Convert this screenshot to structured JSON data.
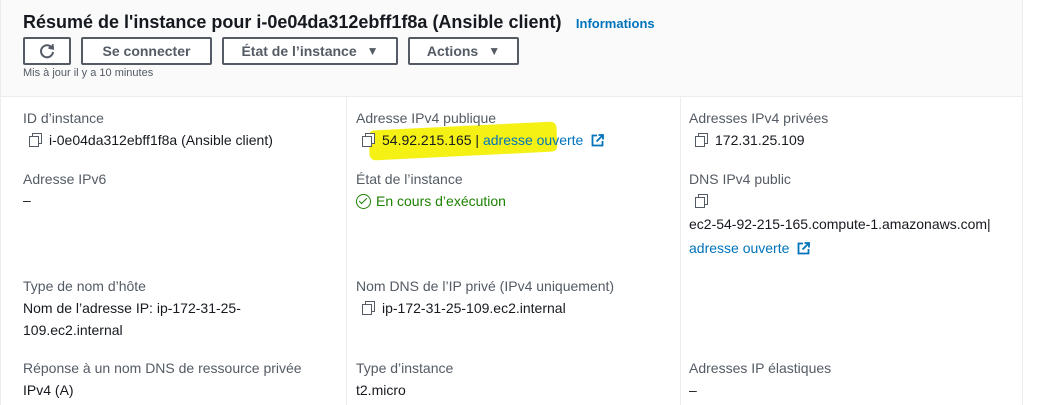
{
  "header": {
    "title": "Résumé de l'instance pour i-0e04da312ebff1f8a (Ansible client)",
    "info_link": "Informations",
    "connect_button": "Se connecter",
    "state_button": "État de l’instance",
    "actions_button": "Actions",
    "updated": "Mis à jour il y a 10 minutes"
  },
  "fields": {
    "instance_id": {
      "label": "ID d’instance",
      "value": "i-0e04da312ebff1f8a (Ansible client)"
    },
    "public_ipv4": {
      "label": "Adresse IPv4 publique",
      "value": "54.92.215.165",
      "separator": "|",
      "link": "adresse ouverte"
    },
    "private_ipv4": {
      "label": "Adresses IPv4 privées",
      "value": "172.31.25.109"
    },
    "ipv6": {
      "label": "Adresse IPv6",
      "value": "–"
    },
    "instance_state": {
      "label": "État de l’instance",
      "value": "En cours d’exécution"
    },
    "public_dns": {
      "label": "DNS IPv4 public",
      "value": "ec2-54-92-215-165.compute-1.amazonaws.com|",
      "link": "adresse ouverte"
    },
    "hostname_type": {
      "label": "Type de nom d’hôte",
      "value_line1": "Nom de l’adresse IP: ip-172-31-25-",
      "value_line2": "109.ec2.internal"
    },
    "private_dns": {
      "label": "Nom DNS de l’IP privé (IPv4 uniquement)",
      "value": "ip-172-31-25-109.ec2.internal"
    },
    "dns_response": {
      "label": "Réponse à un nom DNS de ressource privée",
      "value": "IPv4 (A)"
    },
    "instance_type": {
      "label": "Type d’instance",
      "value": "t2.micro"
    },
    "elastic_ips": {
      "label": "Adresses IP élastiques",
      "value": "–"
    }
  },
  "colors": {
    "link": "#0073bb",
    "running": "#1d8102",
    "highlight": "#f4f007"
  },
  "icons": [
    "refresh-icon",
    "copy-icon",
    "external-link-icon",
    "check-circle-icon",
    "caret-down-icon"
  ]
}
